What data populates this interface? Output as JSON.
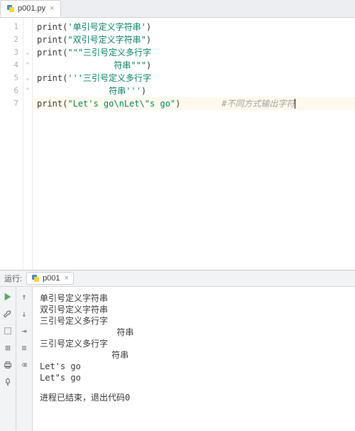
{
  "tabs": {
    "file": {
      "name": "p001.py"
    }
  },
  "gutter": [
    "1",
    "2",
    "3",
    "4",
    "5",
    "6",
    "7"
  ],
  "code": {
    "l1": {
      "f": "print",
      "p1": "(",
      "s": "'单引号定义字符串'",
      "p2": ")"
    },
    "l2": {
      "f": "print",
      "p1": "(",
      "s": "\"双引号定义字符串\"",
      "p2": ")"
    },
    "l3": {
      "f": "print",
      "p1": "(",
      "s": "\"\"\"三引号定义多行字"
    },
    "l4": {
      "s": "               符串\"\"\"",
      "p2": ")"
    },
    "l5": {
      "f": "print",
      "p1": "(",
      "s": "'''三引号定义多行字"
    },
    "l6": {
      "s": "              符串'''",
      "p2": ")"
    },
    "l7": {
      "f": "print",
      "p1": "(",
      "s": "\"Let's go\\nLet\\\"s go\"",
      "p2": ")",
      "comment": "#不同方式输出字符"
    }
  },
  "run": {
    "label": "运行:",
    "name": "p001",
    "out": [
      "单引号定义字符串",
      "双引号定义字符串",
      "三引号定义多行字",
      "               符串",
      "三引号定义多行字",
      "              符串",
      "Let's go",
      "Let\"s go"
    ],
    "end": "进程已结束，退出代码0"
  }
}
